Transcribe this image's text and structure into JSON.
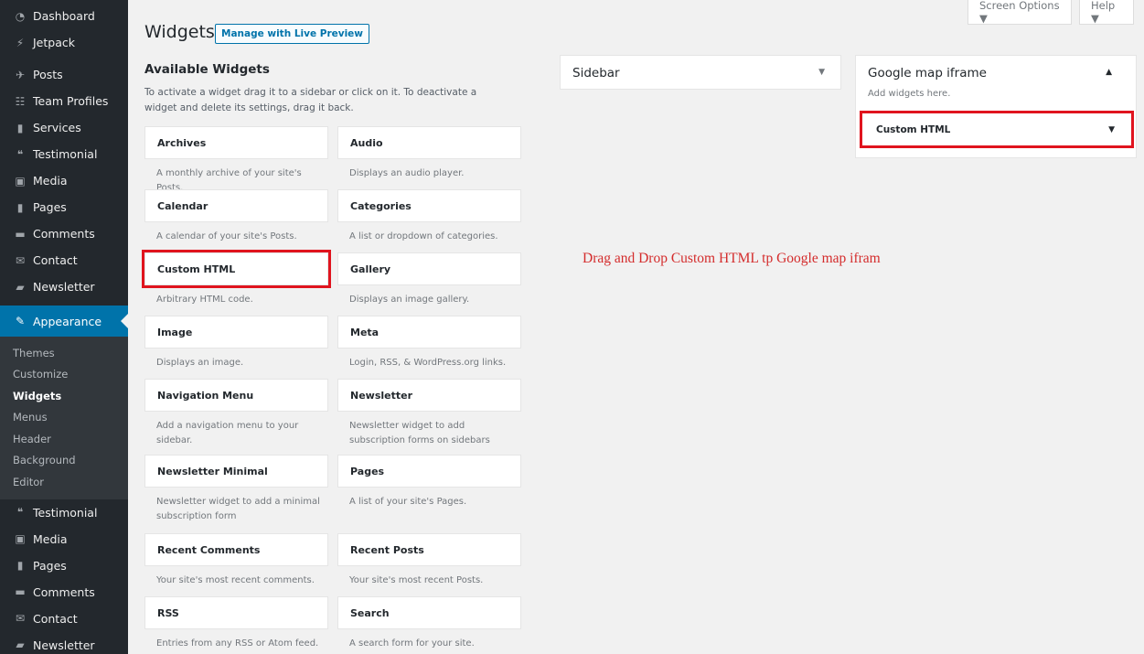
{
  "admin_menu": {
    "top_items": [
      {
        "label": "Dashboard",
        "icon": "dashboard-icon"
      },
      {
        "label": "Jetpack",
        "icon": "jetpack-icon"
      },
      {
        "label": "Posts",
        "icon": "pin-icon"
      },
      {
        "label": "Team Profiles",
        "icon": "groups-icon"
      },
      {
        "label": "Services",
        "icon": "page-icon"
      },
      {
        "label": "Testimonial",
        "icon": "quote-icon"
      },
      {
        "label": "Media",
        "icon": "media-icon"
      },
      {
        "label": "Pages",
        "icon": "page-icon"
      },
      {
        "label": "Comments",
        "icon": "comment-icon"
      },
      {
        "label": "Contact",
        "icon": "envelope-icon"
      },
      {
        "label": "Newsletter",
        "icon": "newsletter-icon"
      }
    ],
    "current_item": {
      "label": "Appearance",
      "icon": "brush-icon"
    },
    "submenu": [
      "Themes",
      "Customize",
      "Widgets",
      "Menus",
      "Header",
      "Background",
      "Editor"
    ],
    "bottom_items": [
      {
        "label": "Testimonial",
        "icon": "quote-icon"
      },
      {
        "label": "Media",
        "icon": "media-icon"
      },
      {
        "label": "Pages",
        "icon": "page-icon"
      },
      {
        "label": "Comments",
        "icon": "comment-icon"
      },
      {
        "label": "Contact",
        "icon": "envelope-icon"
      },
      {
        "label": "Newsletter",
        "icon": "newsletter-icon"
      }
    ]
  },
  "screen_meta": {
    "screen_options": "Screen Options ▼",
    "help": "Help ▼"
  },
  "page": {
    "title": "Widgets",
    "live_preview_button": "Manage with Live Preview"
  },
  "available": {
    "heading": "Available Widgets",
    "description": "To activate a widget drag it to a sidebar or click on it. To deactivate a widget and delete its settings, drag it back."
  },
  "widgets": [
    {
      "title": "Archives",
      "desc": "A monthly archive of your site's Posts."
    },
    {
      "title": "Audio",
      "desc": "Displays an audio player."
    },
    {
      "title": "Calendar",
      "desc": "A calendar of your site's Posts."
    },
    {
      "title": "Categories",
      "desc": "A list or dropdown of categories."
    },
    {
      "title": "Custom HTML",
      "desc": "Arbitrary HTML code."
    },
    {
      "title": "Gallery",
      "desc": "Displays an image gallery."
    },
    {
      "title": "Image",
      "desc": "Displays an image."
    },
    {
      "title": "Meta",
      "desc": "Login, RSS, & WordPress.org links."
    },
    {
      "title": "Navigation Menu",
      "desc": "Add a navigation menu to your sidebar."
    },
    {
      "title": "Newsletter",
      "desc": "Newsletter widget to add subscription forms on sidebars"
    },
    {
      "title": "Newsletter Minimal",
      "desc": "Newsletter widget to add a minimal subscription form"
    },
    {
      "title": "Pages",
      "desc": "A list of your site's Pages."
    },
    {
      "title": "Recent Comments",
      "desc": "Your site's most recent comments."
    },
    {
      "title": "Recent Posts",
      "desc": "Your site's most recent Posts."
    },
    {
      "title": "RSS",
      "desc": "Entries from any RSS or Atom feed."
    },
    {
      "title": "Search",
      "desc": "A search form for your site."
    }
  ],
  "sidebars": {
    "sidebar": {
      "name": "Sidebar",
      "caret": "▼"
    },
    "google_map": {
      "name": "Google map iframe",
      "caret": "▲",
      "empty_text": "Add widgets here.",
      "placed_widget": "Custom HTML",
      "placed_caret": "▼"
    }
  },
  "annotation": "Drag and Drop Custom HTML tp Google map ifram",
  "colors": {
    "sidebar_bg": "#23282d",
    "active": "#0073aa",
    "highlight": "#e0141e"
  }
}
